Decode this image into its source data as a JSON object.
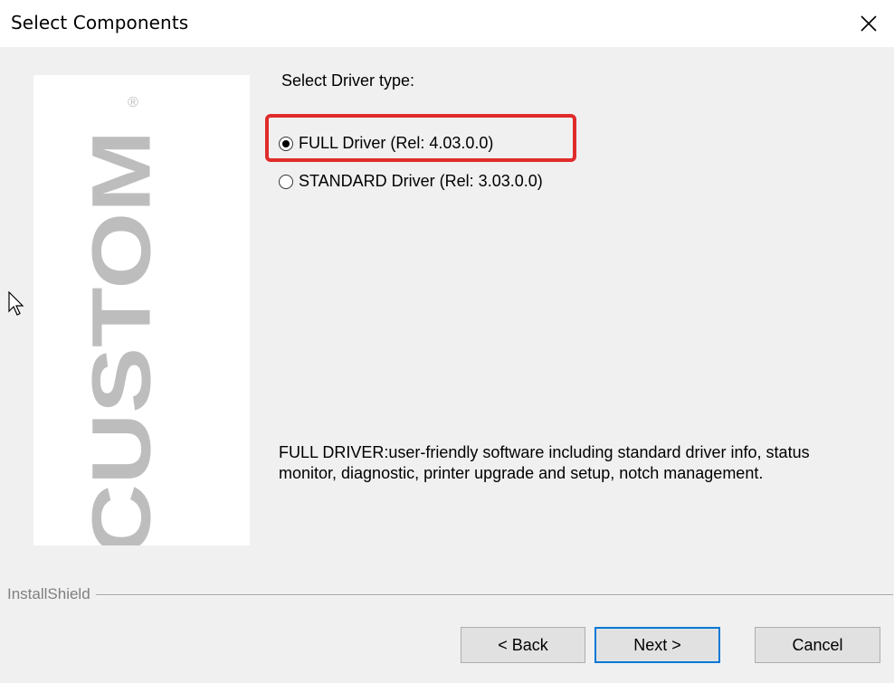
{
  "window": {
    "title": "Select Components",
    "close_icon": "close-icon"
  },
  "logo": {
    "brand": "CUSTOM",
    "registered_mark": "®",
    "color": "#bdbdbd"
  },
  "heading": "Select Driver type:",
  "driver_options": [
    {
      "label": "FULL Driver (Rel: 4.03.0.0)",
      "checked": true
    },
    {
      "label": "STANDARD Driver (Rel: 3.03.0.0)",
      "checked": false
    }
  ],
  "highlight_color": "#e02b2b",
  "description": "FULL DRIVER:user-friendly software including standard driver info, status monitor, diagnostic, printer upgrade and setup, notch management.",
  "footer": {
    "installshield_label": "InstallShield"
  },
  "buttons": {
    "back": "< Back",
    "next": "Next >",
    "cancel": "Cancel"
  },
  "accent_color": "#0078d7"
}
